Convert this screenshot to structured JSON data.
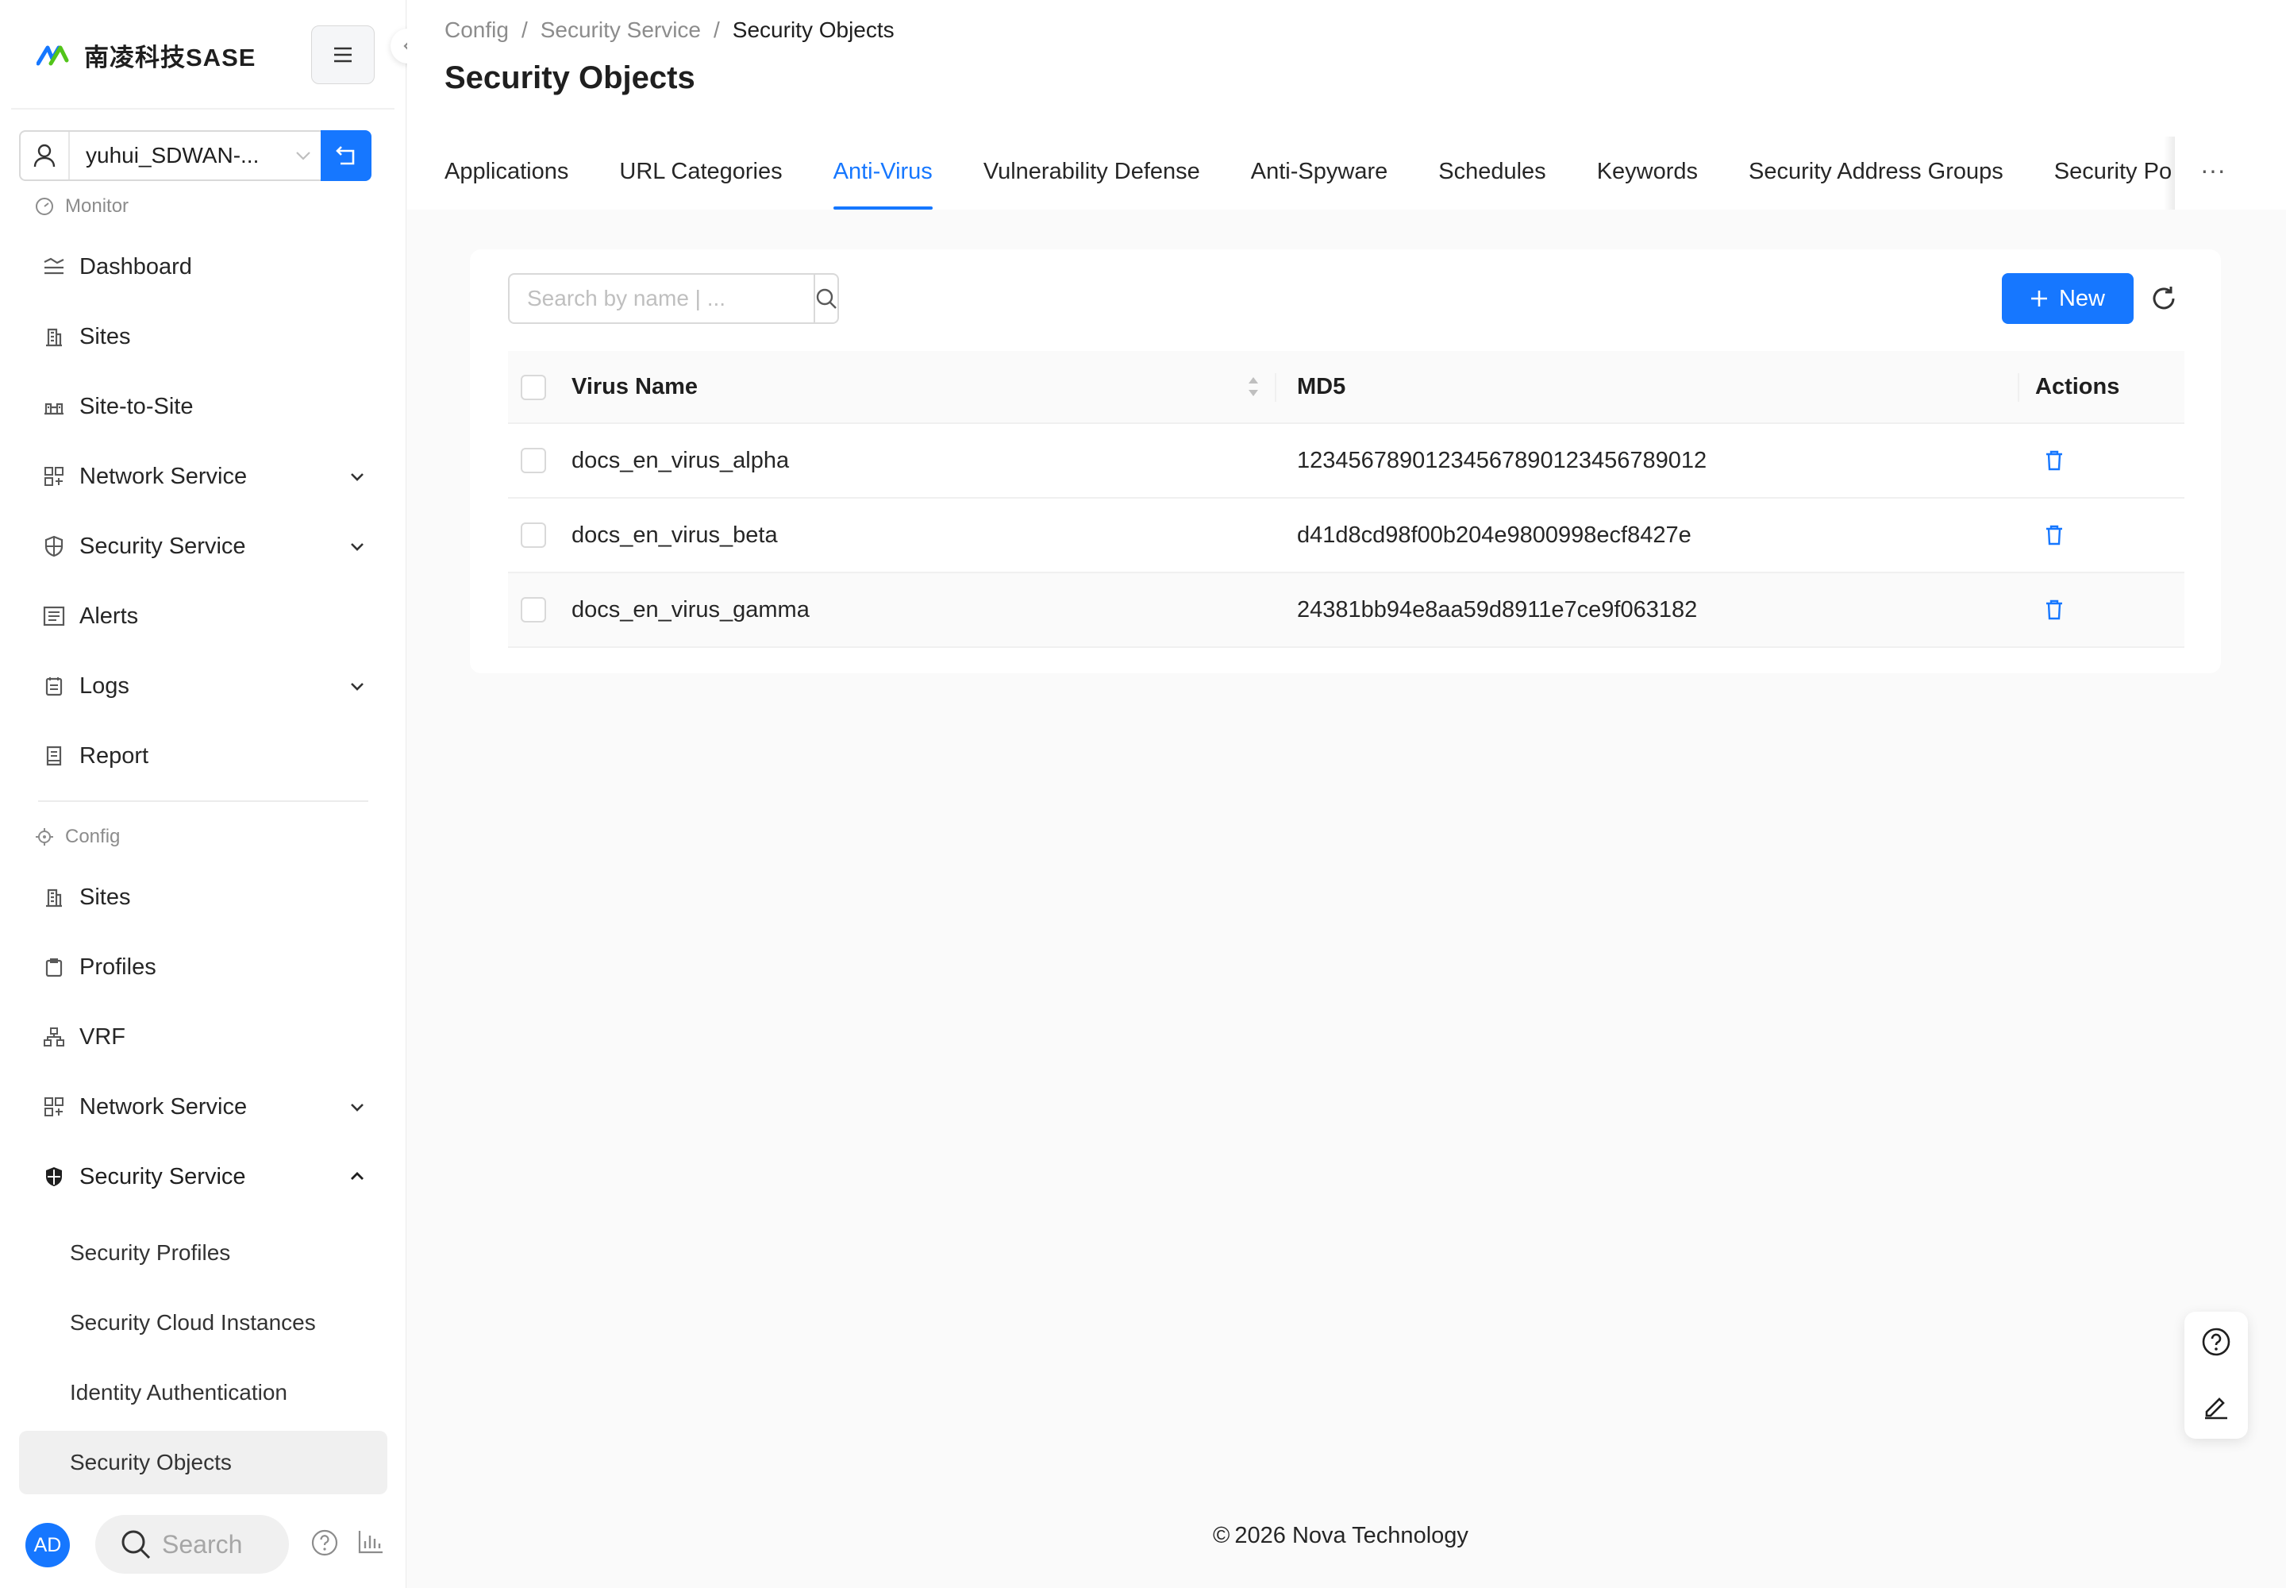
{
  "app": {
    "name": "南凌科技SASE"
  },
  "tenant": {
    "name": "yuhui_SDWAN-..."
  },
  "sidebar": {
    "monitor_title": "Monitor",
    "monitor_items": [
      {
        "label": "Dashboard",
        "icon": "dashboard-icon"
      },
      {
        "label": "Sites",
        "icon": "building-icon"
      },
      {
        "label": "Site-to-Site",
        "icon": "site-to-site-icon"
      },
      {
        "label": "Network Service",
        "icon": "network-icon",
        "expandable": true
      },
      {
        "label": "Security Service",
        "icon": "shield-icon",
        "expandable": true
      },
      {
        "label": "Alerts",
        "icon": "alerts-icon"
      },
      {
        "label": "Logs",
        "icon": "logs-icon",
        "expandable": true
      },
      {
        "label": "Report",
        "icon": "report-icon"
      }
    ],
    "config_title": "Config",
    "config_items": [
      {
        "label": "Sites",
        "icon": "building-icon"
      },
      {
        "label": "Profiles",
        "icon": "profiles-icon"
      },
      {
        "label": "VRF",
        "icon": "vrf-icon"
      },
      {
        "label": "Network Service",
        "icon": "network-icon",
        "expandable": true
      },
      {
        "label": "Security Service",
        "icon": "shield-icon",
        "expanded": true
      }
    ],
    "security_sub_items": [
      {
        "label": "Security Profiles"
      },
      {
        "label": "Security Cloud Instances"
      },
      {
        "label": "Identity Authentication"
      },
      {
        "label": "Security Objects",
        "active": true
      }
    ],
    "bottom": {
      "avatar": "AD",
      "search_label": "Search"
    }
  },
  "breadcrumb": {
    "items": [
      "Config",
      "Security Service",
      "Security Objects"
    ],
    "separator": "/"
  },
  "page": {
    "title": "Security Objects"
  },
  "tabs": {
    "items": [
      "Applications",
      "URL Categories",
      "Anti-Virus",
      "Vulnerability Defense",
      "Anti-Spyware",
      "Schedules",
      "Keywords",
      "Security Address Groups",
      "Security Po"
    ],
    "active": "Anti-Virus",
    "more": "···"
  },
  "toolbar": {
    "search_placeholder": "Search by name | ...",
    "search_value": "",
    "new_label": "New"
  },
  "table": {
    "columns": [
      "Virus Name",
      "MD5",
      "Actions"
    ],
    "rows": [
      {
        "name": "docs_en_virus_alpha",
        "md5": "12345678901234567890123456789012"
      },
      {
        "name": "docs_en_virus_beta",
        "md5": "d41d8cd98f00b204e9800998ecf8427e"
      },
      {
        "name": "docs_en_virus_gamma",
        "md5": "24381bb94e8aa59d8911e7ce9f063182"
      }
    ]
  },
  "footer": {
    "copyright_symbol": "©",
    "text": "2026 Nova Technology"
  },
  "colors": {
    "accent": "#1677ff",
    "text": "#1f1f1f",
    "muted": "#8c8c8c",
    "background": "#fafafa"
  }
}
